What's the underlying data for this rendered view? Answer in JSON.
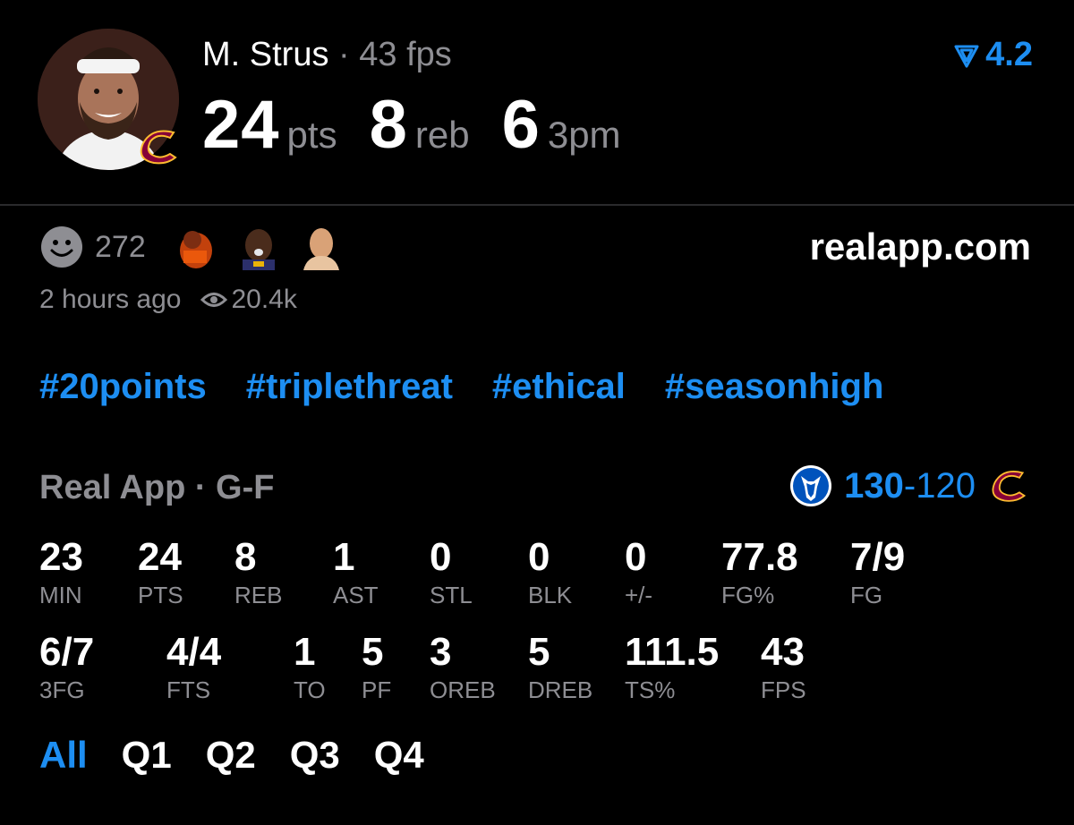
{
  "player": {
    "name": "M. Strus",
    "separator": "·",
    "fps": "43 fps",
    "pts_value": "24",
    "pts_unit": "pts",
    "reb_value": "8",
    "reb_unit": "reb",
    "threes_value": "6",
    "threes_unit": "3pm",
    "rating": "4.2"
  },
  "social": {
    "reaction_count": "272",
    "site": "realapp.com",
    "time_ago": "2 hours ago",
    "views": "20.4k"
  },
  "tags": [
    "#20points",
    "#triplethreat",
    "#ethical",
    "#seasonhigh"
  ],
  "game": {
    "source": "Real App · G-F",
    "home_score": "130",
    "dash": "-",
    "away_score": "120"
  },
  "box_row1": [
    {
      "value": "23",
      "label": "MIN"
    },
    {
      "value": "24",
      "label": "PTS"
    },
    {
      "value": "8",
      "label": "REB"
    },
    {
      "value": "1",
      "label": "AST"
    },
    {
      "value": "0",
      "label": "STL"
    },
    {
      "value": "0",
      "label": "BLK"
    },
    {
      "value": "0",
      "label": "+/-"
    },
    {
      "value": "77.8",
      "label": "FG%"
    },
    {
      "value": "7/9",
      "label": "FG"
    }
  ],
  "box_row2": [
    {
      "value": "6/7",
      "label": "3FG"
    },
    {
      "value": "4/4",
      "label": "FTS"
    },
    {
      "value": "1",
      "label": "TO"
    },
    {
      "value": "5",
      "label": "PF"
    },
    {
      "value": "3",
      "label": "OREB"
    },
    {
      "value": "5",
      "label": "DREB"
    },
    {
      "value": "111.5",
      "label": "TS%"
    },
    {
      "value": "43",
      "label": "FPS"
    }
  ],
  "periods": [
    "All",
    "Q1",
    "Q2",
    "Q3",
    "Q4"
  ],
  "colors": {
    "accent": "#1d8ef2",
    "muted": "#8e8e93",
    "background": "#000000"
  }
}
